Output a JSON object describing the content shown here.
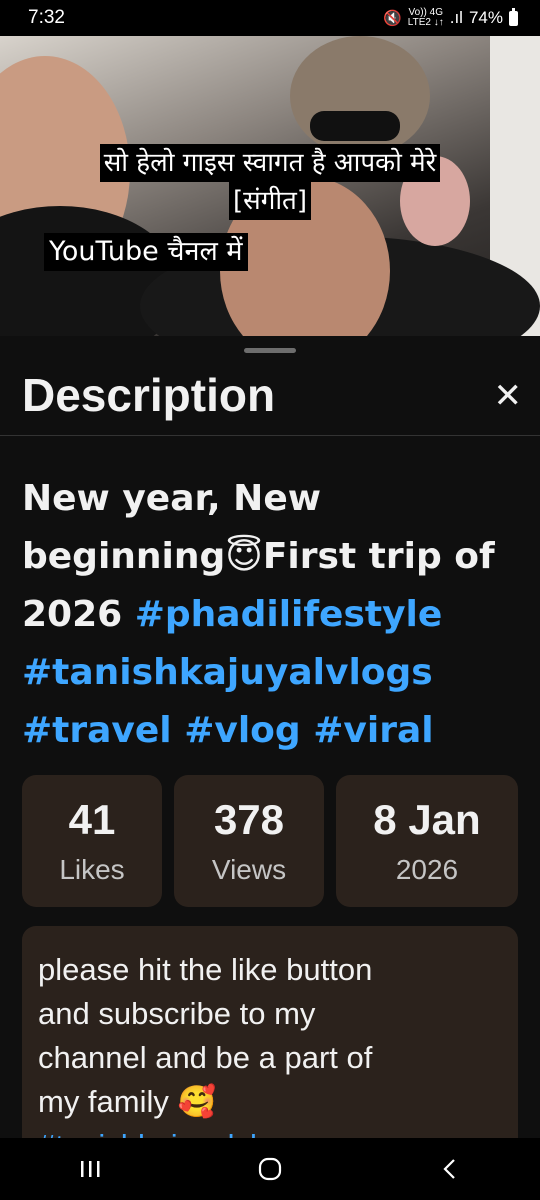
{
  "status_bar": {
    "time": "7:32",
    "network_top": "Vo)) 4G",
    "network_bottom": "LTE2 ↓↑",
    "signal": ".ıl",
    "battery": "74%"
  },
  "video": {
    "captions": [
      "सो हेलो गाइस स्वागत है आपको मेरे",
      "[संगीत]",
      "YouTube चैनल में"
    ]
  },
  "description_sheet": {
    "title": "Description",
    "close_icon": "✕",
    "video_title": {
      "text_part1": "New year, New beginning",
      "emoji": "😇",
      "text_part2": "First trip of 2026 ",
      "hashtags": [
        "#phadilifestyle",
        "#tanishkajuyalvlogs",
        "#travel",
        "#vlog",
        "#viral"
      ]
    },
    "stats": [
      {
        "value": "41",
        "label": "Likes"
      },
      {
        "value": "378",
        "label": "Views"
      },
      {
        "value": "8 Jan",
        "label": "2026"
      }
    ],
    "description_text": "please hit the like button and subscribe to my channel and be a part of my family",
    "description_emoji": "🥰",
    "description_tag_partial": "#tanishkajuyalvl..."
  },
  "navbar": {
    "icons": [
      "recent-apps-icon",
      "home-icon",
      "back-icon"
    ]
  },
  "colors": {
    "link": "#3ea6ff",
    "card_bg": "#2b221c",
    "background": "#0f0f0f"
  }
}
